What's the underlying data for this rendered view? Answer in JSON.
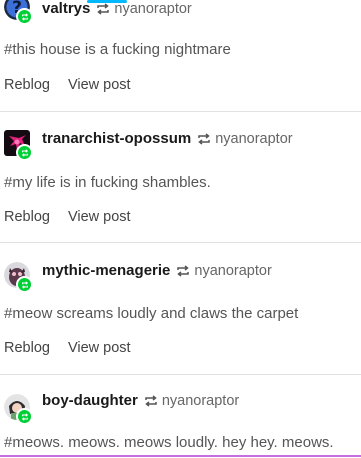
{
  "accent_colors": {
    "reblog_badge": "#00cf35",
    "top_accent": "#00b8ff",
    "bottom_accent": "#c46fe0"
  },
  "notes": [
    {
      "blog": "valtrys",
      "reblogged_from": "nyanoraptor",
      "tags": "#this house is a fucking nightmare",
      "reblog_label": "Reblog",
      "view_label": "View post"
    },
    {
      "blog": "tranarchist-opossum",
      "reblogged_from": "nyanoraptor",
      "tags": "#my life is in fucking shambles.",
      "reblog_label": "Reblog",
      "view_label": "View post"
    },
    {
      "blog": "mythic-menagerie",
      "reblogged_from": "nyanoraptor",
      "tags": "#meow screams loudly and claws the carpet",
      "reblog_label": "Reblog",
      "view_label": "View post"
    },
    {
      "blog": "boy-daughter",
      "reblogged_from": "nyanoraptor",
      "tags": "#meows. meows. meows loudly. hey hey. meows."
    }
  ]
}
